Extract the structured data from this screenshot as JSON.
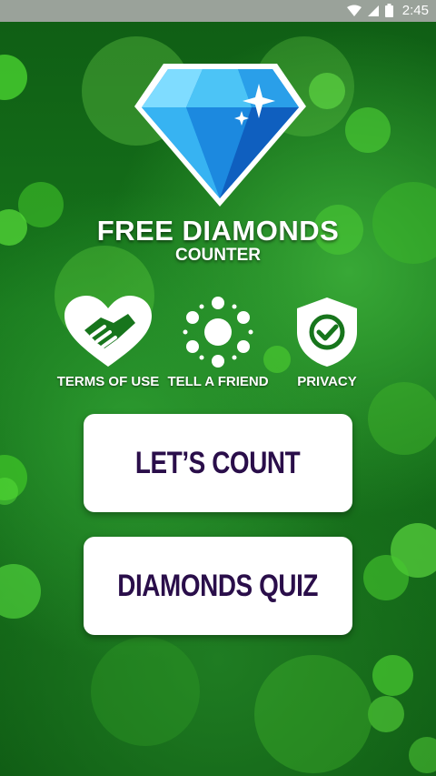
{
  "status_bar": {
    "time": "2:45",
    "icons": [
      "wifi-icon",
      "signal-icon",
      "battery-icon"
    ]
  },
  "app": {
    "title": "FREE DIAMONDS",
    "subtitle": "COUNTER"
  },
  "quick_actions": [
    {
      "label": "TERMS OF USE",
      "icon": "handshake-heart-icon"
    },
    {
      "label": "TELL A FRIEND",
      "icon": "share-network-icon"
    },
    {
      "label": "PRIVACY",
      "icon": "shield-check-icon"
    }
  ],
  "buttons": {
    "count_label": "LET’S COUNT",
    "quiz_label": "DIAMONDS QUIZ"
  },
  "colors": {
    "button_text": "#2a0e4a",
    "background": "#16741b",
    "diamond": "#2fb4f0"
  }
}
